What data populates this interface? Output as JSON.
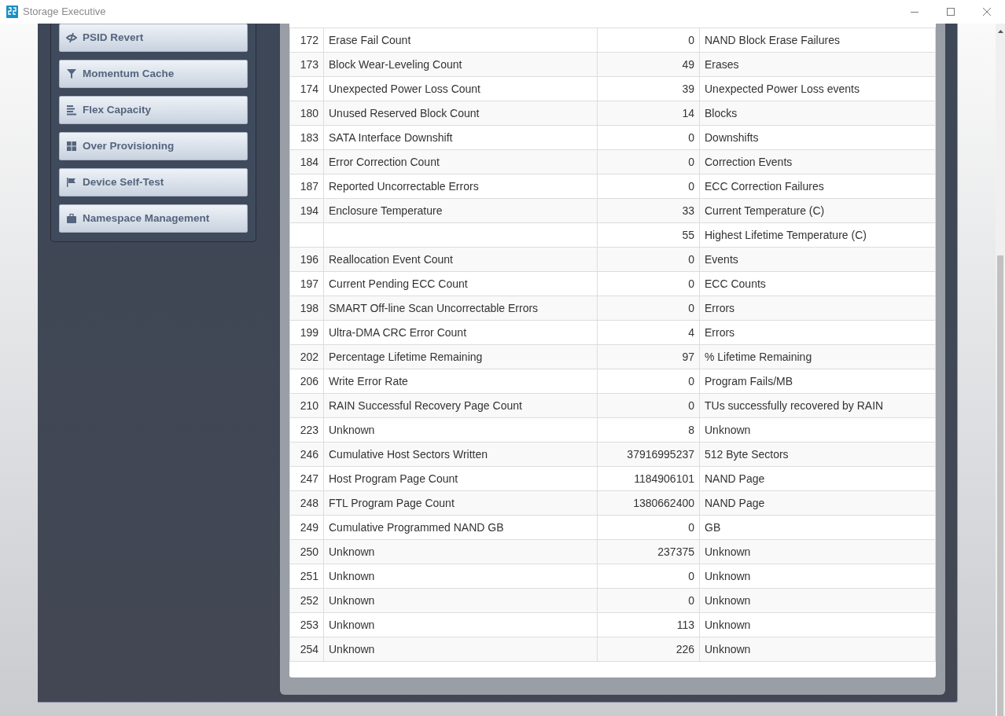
{
  "window": {
    "title": "Storage Executive"
  },
  "sidebar": {
    "items": [
      {
        "label": "PSID Revert",
        "kind": "eye"
      },
      {
        "label": "Momentum Cache",
        "kind": "filter"
      },
      {
        "label": "Flex Capacity",
        "kind": "lines"
      },
      {
        "label": "Over Provisioning",
        "kind": "grid"
      },
      {
        "label": "Device Self-Test",
        "kind": "flag"
      },
      {
        "label": "Namespace Management",
        "kind": "briefcase"
      }
    ]
  },
  "table": {
    "rows": [
      [
        "172",
        "Erase Fail Count",
        "0",
        "NAND Block Erase Failures"
      ],
      [
        "173",
        "Block Wear-Leveling Count",
        "49",
        "Erases"
      ],
      [
        "174",
        "Unexpected Power Loss Count",
        "39",
        "Unexpected Power Loss events"
      ],
      [
        "180",
        "Unused Reserved Block Count",
        "14",
        "Blocks"
      ],
      [
        "183",
        "SATA Interface Downshift",
        "0",
        "Downshifts"
      ],
      [
        "184",
        "Error Correction Count",
        "0",
        "Correction Events"
      ],
      [
        "187",
        "Reported Uncorrectable Errors",
        "0",
        "ECC Correction Failures"
      ],
      [
        "194",
        "Enclosure Temperature",
        "33",
        "Current Temperature (C)"
      ],
      [
        "",
        "",
        "55",
        "Highest Lifetime Temperature (C)"
      ],
      [
        "196",
        "Reallocation Event Count",
        "0",
        "Events"
      ],
      [
        "197",
        "Current Pending ECC Count",
        "0",
        "ECC Counts"
      ],
      [
        "198",
        "SMART Off-line Scan Uncorrectable Errors",
        "0",
        "Errors"
      ],
      [
        "199",
        "Ultra-DMA CRC Error Count",
        "4",
        "Errors"
      ],
      [
        "202",
        "Percentage Lifetime Remaining",
        "97",
        "% Lifetime Remaining"
      ],
      [
        "206",
        "Write Error Rate",
        "0",
        "Program Fails/MB"
      ],
      [
        "210",
        "RAIN Successful Recovery Page Count",
        "0",
        "TUs successfully recovered by RAIN"
      ],
      [
        "223",
        "Unknown",
        "8",
        "Unknown"
      ],
      [
        "246",
        "Cumulative Host Sectors Written",
        "37916995237",
        "512 Byte Sectors"
      ],
      [
        "247",
        "Host Program Page Count",
        "1184906101",
        "NAND Page"
      ],
      [
        "248",
        "FTL Program Page Count",
        "1380662400",
        "NAND Page"
      ],
      [
        "249",
        "Cumulative Programmed NAND GB",
        "0",
        "GB"
      ],
      [
        "250",
        "Unknown",
        "237375",
        "Unknown"
      ],
      [
        "251",
        "Unknown",
        "0",
        "Unknown"
      ],
      [
        "252",
        "Unknown",
        "0",
        "Unknown"
      ],
      [
        "253",
        "Unknown",
        "113",
        "Unknown"
      ],
      [
        "254",
        "Unknown",
        "226",
        "Unknown"
      ]
    ]
  }
}
